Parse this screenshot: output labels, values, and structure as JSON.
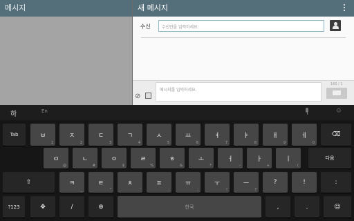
{
  "left_header": {
    "title": "메시지"
  },
  "right_header": {
    "title": "새 메시지"
  },
  "recipient": {
    "label": "수신",
    "placeholder": "수신인을 입력하세요."
  },
  "compose": {
    "placeholder": "메시지를 입력하세요.",
    "counter": "160 / 1"
  },
  "keyboard": {
    "lang_icon": "하",
    "lang_en": "En",
    "rows": {
      "row1": [
        {
          "id": "tab",
          "label": "Tab",
          "sub": ""
        },
        {
          "id": "b",
          "label": "ㅂ",
          "sub": "1"
        },
        {
          "id": "j",
          "label": "ㅈ",
          "sub": "2"
        },
        {
          "id": "d",
          "label": "ㄷ",
          "sub": "3"
        },
        {
          "id": "g",
          "label": "ㄱ",
          "sub": "4"
        },
        {
          "id": "s",
          "label": "ㅅ",
          "sub": "5"
        },
        {
          "id": "yo",
          "label": "ㅛ",
          "sub": "6"
        },
        {
          "id": "yeo",
          "label": "ㅕ",
          "sub": "7"
        },
        {
          "id": "ya",
          "label": "ㅑ",
          "sub": "8"
        },
        {
          "id": "ae",
          "label": "ㅐ",
          "sub": "9"
        },
        {
          "id": "e",
          "label": "ㅔ",
          "sub": "0"
        },
        {
          "id": "backspace",
          "label": "⌫",
          "sub": ""
        }
      ],
      "row2": [
        {
          "id": "m",
          "label": "ㅁ",
          "sub": "@"
        },
        {
          "id": "n",
          "label": "ㄴ",
          "sub": "#"
        },
        {
          "id": "ng",
          "label": "ㅇ",
          "sub": "$"
        },
        {
          "id": "r",
          "label": "ㄹ",
          "sub": "%"
        },
        {
          "id": "h",
          "label": "ㅎ",
          "sub": "&"
        },
        {
          "id": "o",
          "label": "ㅗ",
          "sub": "*"
        },
        {
          "id": "eo",
          "label": "ㅓ",
          "sub": "-"
        },
        {
          "id": "a",
          "label": "ㅏ",
          "sub": "+"
        },
        {
          "id": "i",
          "label": "ㅣ",
          "sub": "("
        },
        {
          "id": "next",
          "label": "다음",
          "sub": ""
        }
      ],
      "row3": [
        {
          "id": "shift",
          "label": "⇧",
          "sub": ""
        },
        {
          "id": "k",
          "label": "ㅋ",
          "sub": "_"
        },
        {
          "id": "t",
          "label": "ㅌ",
          "sub": "\""
        },
        {
          "id": "ch",
          "label": "ㅊ",
          "sub": "'"
        },
        {
          "id": "p",
          "label": "ㅍ",
          "sub": ":"
        },
        {
          "id": "yu",
          "label": "ㅠ",
          "sub": ";"
        },
        {
          "id": "u",
          "label": "ㅜ",
          "sub": "!"
        },
        {
          "id": "eu",
          "label": "ㅡ",
          "sub": "?"
        },
        {
          "id": "question",
          "label": "?",
          "sub": ""
        },
        {
          "id": "exclaim",
          "label": "!",
          "sub": ""
        },
        {
          "id": "colon",
          "label": ":",
          "sub": ""
        }
      ],
      "row4": [
        {
          "id": "symbols",
          "label": "?123",
          "sub": ""
        },
        {
          "id": "cursor",
          "label": "✥",
          "sub": ""
        },
        {
          "id": "slash",
          "label": "/",
          "sub": ""
        },
        {
          "id": "globe",
          "label": "⊕",
          "sub": ""
        },
        {
          "id": "space",
          "label": "",
          "sub": ""
        },
        {
          "id": "comma",
          "label": ",",
          "sub": ""
        },
        {
          "id": "period",
          "label": ".",
          "sub": ""
        },
        {
          "id": "emoji",
          "label": "☺",
          "sub": ""
        }
      ]
    },
    "space_label": "한국"
  }
}
